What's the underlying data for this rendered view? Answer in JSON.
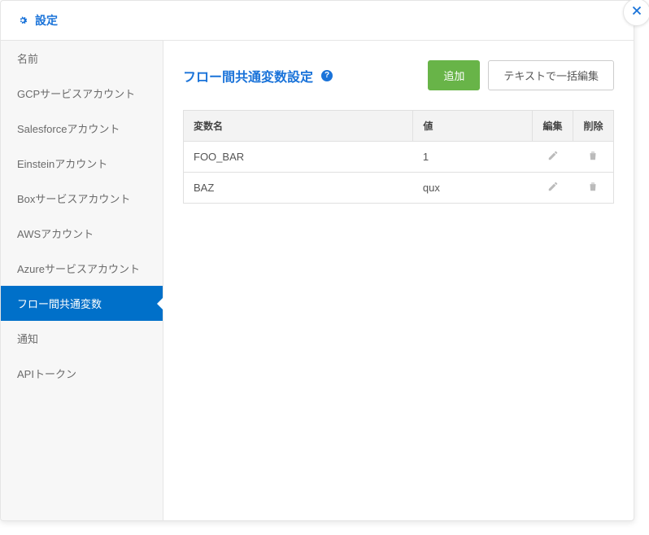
{
  "header": {
    "title": "設定"
  },
  "sidebar": {
    "items": [
      {
        "label": "名前",
        "active": false
      },
      {
        "label": "GCPサービスアカウント",
        "active": false
      },
      {
        "label": "Salesforceアカウント",
        "active": false
      },
      {
        "label": "Einsteinアカウント",
        "active": false
      },
      {
        "label": "Boxサービスアカウント",
        "active": false
      },
      {
        "label": "AWSアカウント",
        "active": false
      },
      {
        "label": "Azureサービスアカウント",
        "active": false
      },
      {
        "label": "フロー間共通変数",
        "active": true
      },
      {
        "label": "通知",
        "active": false
      },
      {
        "label": "APIトークン",
        "active": false
      }
    ]
  },
  "main": {
    "title": "フロー間共通変数設定",
    "help_symbol": "?",
    "buttons": {
      "add": "追加",
      "bulk_edit": "テキストで一括編集"
    },
    "table": {
      "headers": {
        "name": "変数名",
        "value": "値",
        "edit": "編集",
        "delete": "削除"
      },
      "rows": [
        {
          "name": "FOO_BAR",
          "value": "1"
        },
        {
          "name": "BAZ",
          "value": "qux"
        }
      ]
    }
  }
}
